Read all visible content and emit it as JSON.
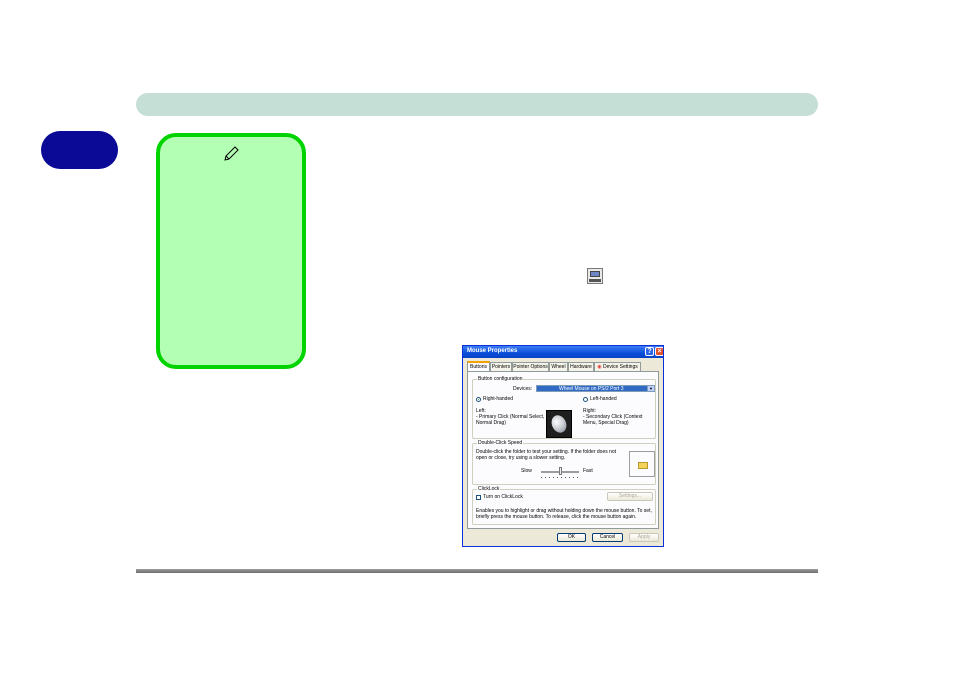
{
  "dialog": {
    "title": "Mouse Properties",
    "help_label": "?",
    "close_label": "×",
    "tabs": [
      {
        "label": "Buttons",
        "active": true
      },
      {
        "label": "Pointers"
      },
      {
        "label": "Pointer Options"
      },
      {
        "label": "Wheel"
      },
      {
        "label": "Hardware"
      },
      {
        "label": "Device Settings"
      }
    ],
    "button_config": {
      "group_label": "Button configuration",
      "devices_label": "Devices:",
      "device_selected": "Wheel Mouse on PS/2 Port 3",
      "right_handed": "Right-handed",
      "left_handed": "Left-handed",
      "left_title": "Left:",
      "left_desc_1": "- Primary Click (Normal Select,",
      "left_desc_2": "Normal Drag)",
      "right_title": "Right:",
      "right_desc_1": "- Secondary Click (Context",
      "right_desc_2": "Menu, Special Drag)"
    },
    "double_click": {
      "group_label": "Double-Click Speed",
      "desc_1": "Double-click the folder to test your setting.  If the folder does not",
      "desc_2": "open or close, try using a slower setting.",
      "slow_label": "Slow",
      "fast_label": "Fast",
      "speed_fraction": 0.5
    },
    "click_lock": {
      "group_label": "ClickLock",
      "checkbox_label": "Turn on ClickLock",
      "settings_label": "Settings...",
      "desc_1": "Enables you to highlight or drag without holding down the mouse button.  To set,",
      "desc_2": "briefly press the mouse button.  To release, click the mouse button again."
    },
    "ok_label": "OK",
    "cancel_label": "Cancel",
    "apply_label": "Apply"
  },
  "icons": {
    "note": "pen-icon",
    "inline": "mouse-control-panel-icon"
  }
}
